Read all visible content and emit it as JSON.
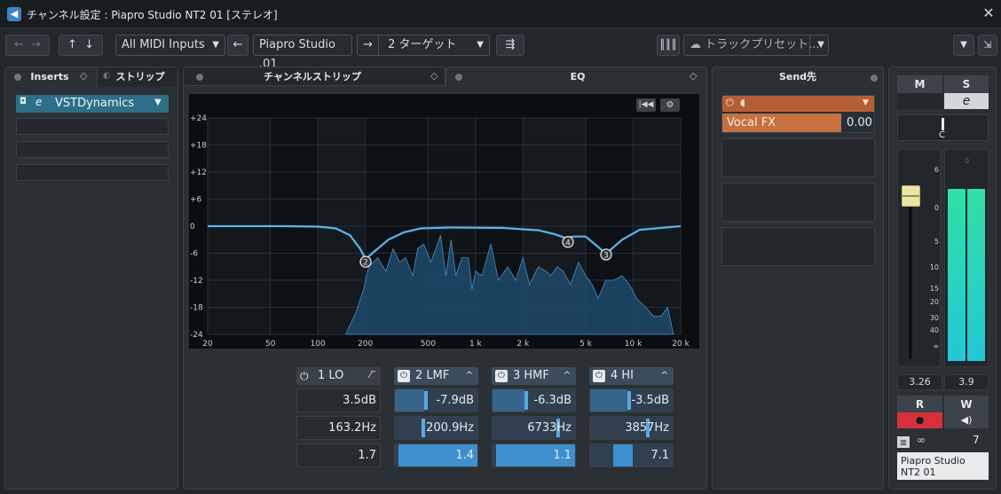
{
  "window": {
    "title": "チャンネル設定 : Piapro Studio NT2 01 [ステレオ]"
  },
  "toolbar": {
    "midi_input": "All MIDI Inputs",
    "track_name": "Piapro Studio .01",
    "target": "2 ターゲット",
    "track_preset_placeholder": "トラックプリセット..."
  },
  "tabs": {
    "inserts": "Inserts",
    "strip": "ストリップ",
    "channel_strip": "チャンネルストリップ",
    "eq": "EQ",
    "sends": "Send先"
  },
  "inserts": {
    "slots": [
      "VSTDynamics",
      "",
      "",
      ""
    ]
  },
  "sends": {
    "slot1_name": "Vocal FX",
    "slot1_level": "0.00"
  },
  "chart_data": {
    "type": "area",
    "xscale": "log",
    "x_ticks": [
      "20",
      "50",
      "100",
      "200",
      "500",
      "1 k",
      "2 k",
      "5 k",
      "10 k",
      "20 k"
    ],
    "y_ticks": [
      "+24",
      "+18",
      "+12",
      "+6",
      "0",
      "-6",
      "-12",
      "-18",
      "-24"
    ],
    "ylim": [
      -24,
      24
    ],
    "xlim": [
      20,
      20000
    ],
    "eq_curve": {
      "x": [
        20,
        60,
        100,
        130,
        160,
        185,
        201,
        230,
        280,
        350,
        450,
        700,
        1500,
        2500,
        3200,
        3700,
        4200,
        5000,
        6733,
        8500,
        11000,
        20000
      ],
      "y": [
        0,
        0,
        -0.1,
        -0.5,
        -2.0,
        -5.0,
        -7.3,
        -5.5,
        -3.0,
        -1.4,
        -0.5,
        -0.3,
        -0.4,
        -0.9,
        -1.8,
        -2.6,
        -2.3,
        -2.3,
        -6.1,
        -3.0,
        -0.8,
        0
      ]
    },
    "spectrum": {
      "x": [
        150,
        175,
        195,
        210,
        240,
        270,
        300,
        330,
        360,
        400,
        430,
        470,
        520,
        560,
        600,
        650,
        700,
        750,
        820,
        900,
        950,
        1000,
        1100,
        1250,
        1400,
        1600,
        1800,
        2000,
        2200,
        2500,
        2800,
        3000,
        3300,
        3600,
        4000,
        4500,
        5000,
        5500,
        6000,
        6700,
        7500,
        8500,
        9500,
        10500,
        12000,
        13500,
        15000,
        16500,
        18000
      ],
      "y": [
        -24,
        -19,
        -14,
        -9,
        -7,
        -10,
        -5,
        -8,
        -7,
        -11,
        -5,
        -4,
        -8,
        -5,
        -2,
        -11,
        -3,
        -11,
        -7,
        -7,
        -14,
        -10,
        -11,
        -4,
        -12,
        -9,
        -12,
        -7,
        -13,
        -9,
        -10,
        -11,
        -9,
        -10,
        -13,
        -8,
        -11,
        -13,
        -16,
        -12,
        -12,
        -11,
        -13,
        -16,
        -18,
        -20,
        -20,
        -18,
        -24
      ]
    },
    "handles": [
      {
        "label": "2",
        "x": 201,
        "y": -7.9
      },
      {
        "label": "4",
        "x": 3857,
        "y": -3.5
      },
      {
        "label": "3",
        "x": 6733,
        "y": -6.3
      }
    ],
    "grid": true
  },
  "eq_bands": [
    {
      "name": "1 LO",
      "gain": "3.5dB",
      "freq": "163.2Hz",
      "q": "1.7",
      "on": false,
      "gain_pos": 0.57,
      "freq_pos": 0.0,
      "q_pos": 0.0
    },
    {
      "name": "2 LMF",
      "gain": "-7.9dB",
      "freq": "200.9Hz",
      "q": "1.4",
      "on": true,
      "gain_pos": 0.36,
      "freq_pos": 0.32,
      "q_pos": 1.0
    },
    {
      "name": "3 HMF",
      "gain": "-6.3dB",
      "freq": "6733Hz",
      "q": "1.1",
      "on": true,
      "gain_pos": 0.39,
      "freq_pos": 0.77,
      "q_pos": 1.0
    },
    {
      "name": "4 HI",
      "gain": "-3.5dB",
      "freq": "3857Hz",
      "q": "7.1",
      "on": true,
      "gain_pos": 0.45,
      "freq_pos": 0.68,
      "q_pos": 0.6
    }
  ],
  "strip": {
    "mute": "M",
    "solo": "S",
    "pan": "C",
    "fader_scale": [
      "6",
      "0",
      "5",
      "10",
      "15",
      "20",
      "30",
      "40",
      "∞"
    ],
    "meter_scale": [
      "0"
    ],
    "fader_readout": "3.26",
    "meter_readout": "3.9",
    "read": "R",
    "write": "W",
    "channel_number": "7",
    "channel_name": "Piapro Studio NT2 01",
    "meter_level": 0.85
  }
}
